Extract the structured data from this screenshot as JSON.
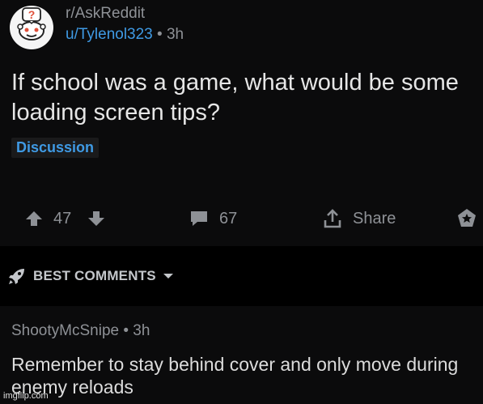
{
  "post": {
    "subreddit": "r/AskReddit",
    "author": "u/Tylenol323",
    "separator": "•",
    "age": "3h",
    "title": "If school was a game, what would be some loading screen tips?",
    "flair": "Discussion",
    "upvotes": "47",
    "comments": "67",
    "share_label": "Share"
  },
  "sort": {
    "label": "BEST COMMENTS"
  },
  "comment": {
    "author": "ShootyMcSnipe",
    "separator": "•",
    "age": "3h",
    "body": "Remember to stay behind cover and only move during enemy reloads"
  },
  "watermark": "imgflip.com",
  "colors": {
    "background": "#0b0b0c",
    "comments_bar": "#000000",
    "accent_blue": "#3f9ae4",
    "muted_text": "#8e9196"
  }
}
